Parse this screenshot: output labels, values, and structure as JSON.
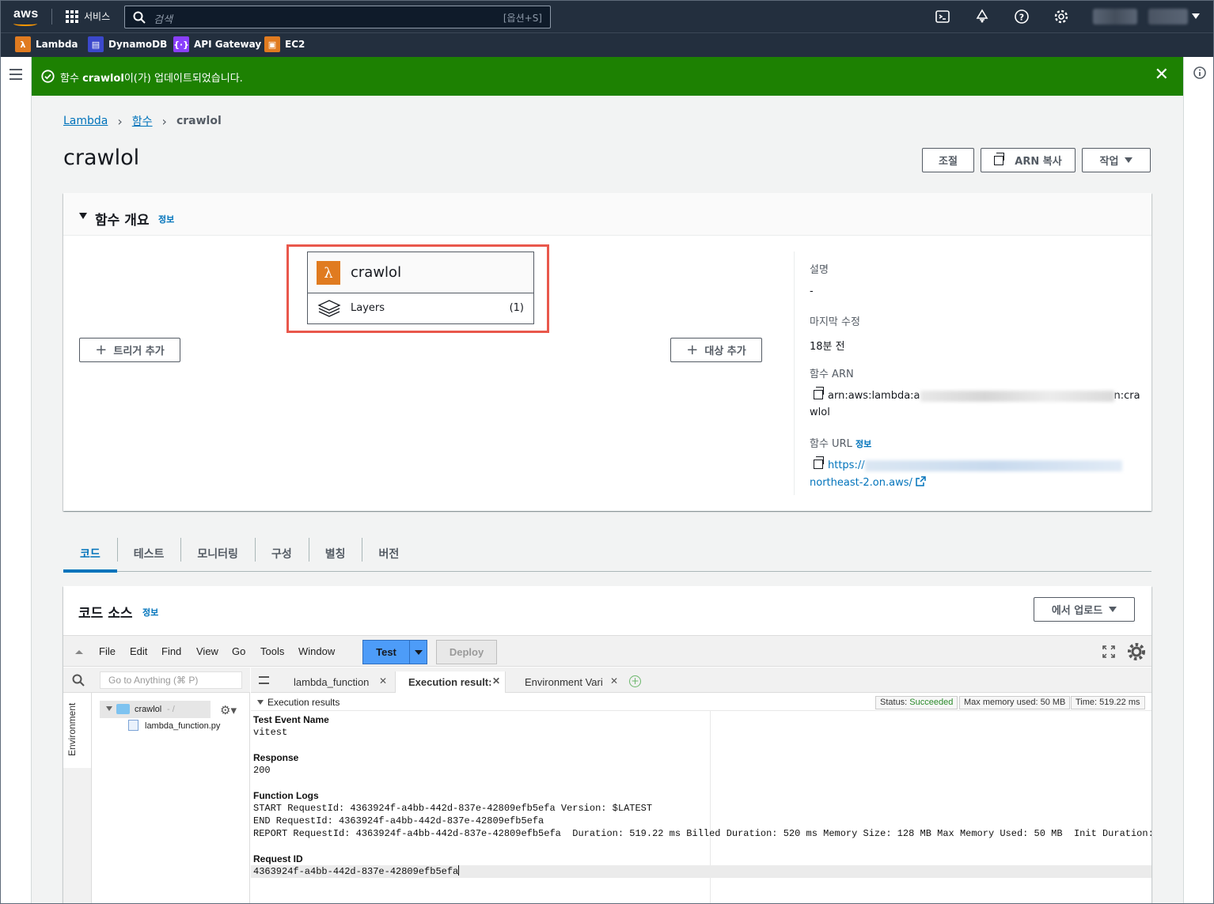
{
  "topnav": {
    "logo": "aws",
    "services_label": "서비스",
    "search_placeholder": "검색",
    "search_shortcut": "[옵션+S]"
  },
  "favorites": [
    {
      "label": "Lambda",
      "icon": "lambda-icon",
      "color": "#e07b20"
    },
    {
      "label": "DynamoDB",
      "icon": "dynamodb-icon",
      "color": "#3b48cc"
    },
    {
      "label": "API Gateway",
      "icon": "api-gateway-icon",
      "color": "#8a3ffc"
    },
    {
      "label": "EC2",
      "icon": "ec2-icon",
      "color": "#e07b20"
    }
  ],
  "flash": {
    "prefix": "함수 ",
    "name": "crawlol",
    "suffix": "이(가) 업데이트되었습니다.",
    "color": "#1d8102"
  },
  "breadcrumb": {
    "root": "Lambda",
    "mid": "함수",
    "current": "crawlol"
  },
  "page": {
    "title": "crawlol",
    "buttons": {
      "throttle": "조절",
      "copy_arn": "ARN 복사",
      "actions": "작업"
    }
  },
  "overview": {
    "title": "함수 개요",
    "info": "정보",
    "function_name": "crawlol",
    "layers_label": "Layers",
    "layers_count": "(1)",
    "add_trigger": "트리거 추가",
    "add_destination": "대상 추가",
    "description_label": "설명",
    "description_value": "-",
    "last_modified_label": "마지막 수정",
    "last_modified_value": "18분 전",
    "arn_label": "함수 ARN",
    "arn_prefix": "arn:aws:lambda:a",
    "arn_suffix": "n:cra",
    "arn_wrap": "wlol",
    "url_label": "함수 URL",
    "url_info": "정보",
    "url_prefix": "https://",
    "url_wrap": "northeast-2.on.aws/"
  },
  "tabs": [
    "코드",
    "테스트",
    "모니터링",
    "구성",
    "별칭",
    "버전"
  ],
  "code_source": {
    "title": "코드 소스",
    "info": "정보",
    "upload_from": "에서 업로드"
  },
  "ide": {
    "menu": [
      "File",
      "Edit",
      "Find",
      "View",
      "Go",
      "Tools",
      "Window"
    ],
    "test_label": "Test",
    "deploy_label": "Deploy",
    "goto_placeholder": "Go to Anything (⌘ P)",
    "env_tab": "Environment",
    "folder": "crawlol",
    "folder_suffix": "- /",
    "file": "lambda_function.py",
    "editor_tabs": [
      "lambda_function",
      "Execution result:",
      "Environment Vari"
    ],
    "results": {
      "title": "Execution results",
      "status_label": "Status: ",
      "status_value": "Succeeded",
      "memory": "Max memory used: 50 MB",
      "time": "Time: 519.22 ms",
      "event_name_label": "Test Event Name",
      "event_name": "vitest",
      "response_label": "Response",
      "response": "200",
      "logs_label": "Function Logs",
      "log1": "START RequestId: 4363924f-a4bb-442d-837e-42809efb5efa Version: $LATEST",
      "log2": "END RequestId: 4363924f-a4bb-442d-837e-42809efb5efa",
      "log3": "REPORT RequestId: 4363924f-a4bb-442d-837e-42809efb5efa  Duration: 519.22 ms Billed Duration: 520 ms Memory Size: 128 MB Max Memory Used: 50 MB  Init Duration:",
      "request_id_label": "Request ID",
      "request_id": "4363924f-a4bb-442d-837e-42809efb5efa"
    }
  }
}
